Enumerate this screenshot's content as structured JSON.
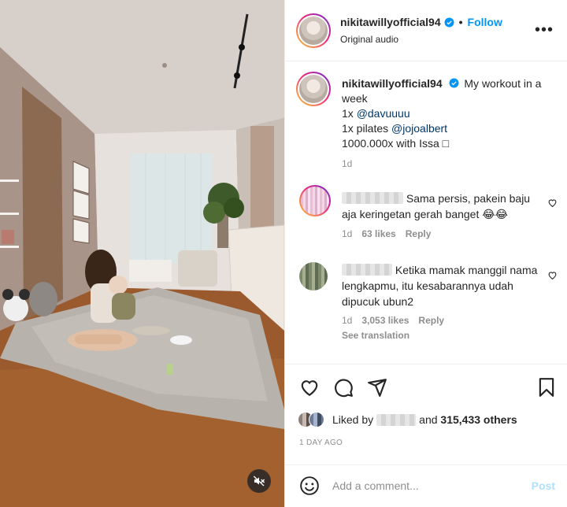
{
  "post": {
    "username": "nikitawillyofficial94",
    "follow_label": "Follow",
    "separator": "•",
    "audio": "Original audio",
    "more_label": "•••"
  },
  "caption": {
    "username": "nikitawillyofficial94",
    "text_line1": "My workout in a week",
    "line2_prefix": "1x ",
    "line2_mention": "@davuuuu",
    "line3_prefix": "1x pilates ",
    "line3_mention": "@jojoalbert",
    "line4": "1000.000x with Issa □",
    "time": "1d"
  },
  "comments": [
    {
      "text": "Sama persis, pakein baju aja keringetan gerah banget 😂😂",
      "time": "1d",
      "likes": "63 likes",
      "reply": "Reply"
    },
    {
      "text": "Ketika mamak manggil nama lengkapmu, itu kesabarannya udah dipucuk ubun2",
      "time": "1d",
      "likes": "3,053 likes",
      "reply": "Reply",
      "see_translation": "See translation"
    }
  ],
  "likes": {
    "prefix": "Liked by",
    "connector": "and",
    "others": "315,433 others"
  },
  "date": "1 DAY AGO",
  "add_comment": {
    "placeholder": "Add a comment...",
    "post_label": "Post"
  },
  "icons": [
    "heart-icon",
    "comment-icon",
    "share-icon",
    "bookmark-icon",
    "emoji-icon",
    "mute-icon",
    "verified-badge-icon",
    "more-options-icon"
  ],
  "colors": {
    "accent": "#0095f6",
    "post_disabled": "#b2dffc",
    "meta": "#8e8e8e",
    "mention": "#00376b"
  }
}
